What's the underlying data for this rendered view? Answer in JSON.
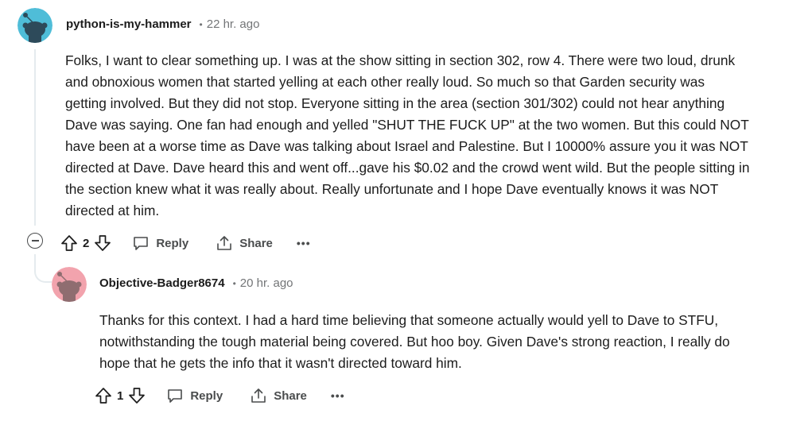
{
  "comments": [
    {
      "username": "python-is-my-hammer",
      "separator": "•",
      "time": "22 hr. ago",
      "avatar_color": "#4fbdd8",
      "body_lines": [
        "Folks, I want to clear something up. I was at the show sitting in section 302, row 4. There were two loud, drunk",
        "and obnoxious women that started yelling at each other really loud. So much so that Garden security was",
        "getting involved. But they did not stop. Everyone sitting in the area (section 301/302) could not hear anything",
        "Dave was saying. One fan had enough and yelled \"SHUT THE FUCK UP\" at the two women. But this could NOT",
        "have been at a worse time as Dave was talking about Israel and Palestine. But I 10000% assure you it was NOT",
        "directed at Dave. Dave heard this and went off...gave his $0.02 and the crowd went wild. But the people sitting in",
        "the section knew what it was really about. Really unfortunate and I hope Dave eventually knows it was NOT",
        "directed at him."
      ],
      "votes": "2",
      "reply_label": "Reply",
      "share_label": "Share",
      "more_label": "•••"
    },
    {
      "username": "Objective-Badger8674",
      "separator": "•",
      "time": "20 hr. ago",
      "avatar_color": "#f2a3ad",
      "body_lines": [
        "Thanks for this context. I had a hard time believing that someone actually would yell to Dave to STFU,",
        "notwithstanding the tough material being covered. But hoo boy. Given Dave's strong reaction, I really do",
        "hope that he gets the info that it wasn't directed toward him."
      ],
      "votes": "1",
      "reply_label": "Reply",
      "share_label": "Share",
      "more_label": "•••"
    }
  ],
  "icons": {
    "avatar": "snoo-avatar-icon",
    "upvote": "upvote-arrow-icon",
    "downvote": "downvote-arrow-icon",
    "reply": "speech-bubble-icon",
    "share": "share-upload-icon",
    "collapse": "minus-circle-icon"
  }
}
